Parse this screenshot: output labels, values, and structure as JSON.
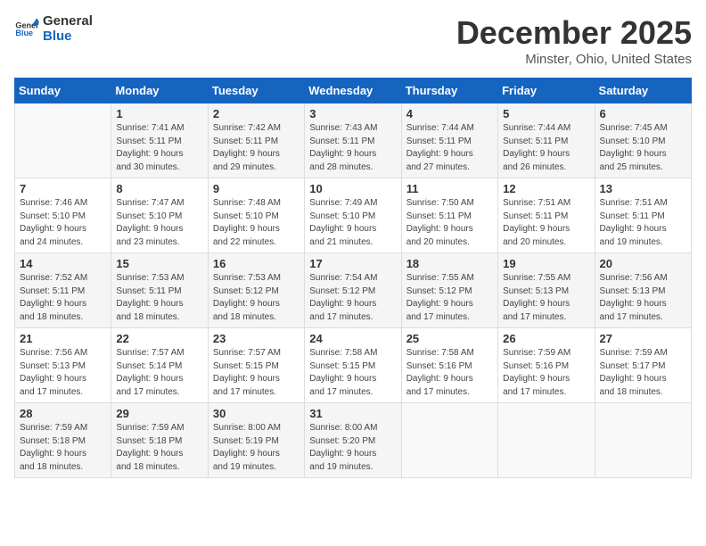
{
  "header": {
    "logo_general": "General",
    "logo_blue": "Blue",
    "month": "December 2025",
    "location": "Minster, Ohio, United States"
  },
  "weekdays": [
    "Sunday",
    "Monday",
    "Tuesday",
    "Wednesday",
    "Thursday",
    "Friday",
    "Saturday"
  ],
  "weeks": [
    [
      {
        "day": "",
        "info": ""
      },
      {
        "day": "1",
        "info": "Sunrise: 7:41 AM\nSunset: 5:11 PM\nDaylight: 9 hours\nand 30 minutes."
      },
      {
        "day": "2",
        "info": "Sunrise: 7:42 AM\nSunset: 5:11 PM\nDaylight: 9 hours\nand 29 minutes."
      },
      {
        "day": "3",
        "info": "Sunrise: 7:43 AM\nSunset: 5:11 PM\nDaylight: 9 hours\nand 28 minutes."
      },
      {
        "day": "4",
        "info": "Sunrise: 7:44 AM\nSunset: 5:11 PM\nDaylight: 9 hours\nand 27 minutes."
      },
      {
        "day": "5",
        "info": "Sunrise: 7:44 AM\nSunset: 5:11 PM\nDaylight: 9 hours\nand 26 minutes."
      },
      {
        "day": "6",
        "info": "Sunrise: 7:45 AM\nSunset: 5:10 PM\nDaylight: 9 hours\nand 25 minutes."
      }
    ],
    [
      {
        "day": "7",
        "info": "Sunrise: 7:46 AM\nSunset: 5:10 PM\nDaylight: 9 hours\nand 24 minutes."
      },
      {
        "day": "8",
        "info": "Sunrise: 7:47 AM\nSunset: 5:10 PM\nDaylight: 9 hours\nand 23 minutes."
      },
      {
        "day": "9",
        "info": "Sunrise: 7:48 AM\nSunset: 5:10 PM\nDaylight: 9 hours\nand 22 minutes."
      },
      {
        "day": "10",
        "info": "Sunrise: 7:49 AM\nSunset: 5:10 PM\nDaylight: 9 hours\nand 21 minutes."
      },
      {
        "day": "11",
        "info": "Sunrise: 7:50 AM\nSunset: 5:11 PM\nDaylight: 9 hours\nand 20 minutes."
      },
      {
        "day": "12",
        "info": "Sunrise: 7:51 AM\nSunset: 5:11 PM\nDaylight: 9 hours\nand 20 minutes."
      },
      {
        "day": "13",
        "info": "Sunrise: 7:51 AM\nSunset: 5:11 PM\nDaylight: 9 hours\nand 19 minutes."
      }
    ],
    [
      {
        "day": "14",
        "info": "Sunrise: 7:52 AM\nSunset: 5:11 PM\nDaylight: 9 hours\nand 18 minutes."
      },
      {
        "day": "15",
        "info": "Sunrise: 7:53 AM\nSunset: 5:11 PM\nDaylight: 9 hours\nand 18 minutes."
      },
      {
        "day": "16",
        "info": "Sunrise: 7:53 AM\nSunset: 5:12 PM\nDaylight: 9 hours\nand 18 minutes."
      },
      {
        "day": "17",
        "info": "Sunrise: 7:54 AM\nSunset: 5:12 PM\nDaylight: 9 hours\nand 17 minutes."
      },
      {
        "day": "18",
        "info": "Sunrise: 7:55 AM\nSunset: 5:12 PM\nDaylight: 9 hours\nand 17 minutes."
      },
      {
        "day": "19",
        "info": "Sunrise: 7:55 AM\nSunset: 5:13 PM\nDaylight: 9 hours\nand 17 minutes."
      },
      {
        "day": "20",
        "info": "Sunrise: 7:56 AM\nSunset: 5:13 PM\nDaylight: 9 hours\nand 17 minutes."
      }
    ],
    [
      {
        "day": "21",
        "info": "Sunrise: 7:56 AM\nSunset: 5:13 PM\nDaylight: 9 hours\nand 17 minutes."
      },
      {
        "day": "22",
        "info": "Sunrise: 7:57 AM\nSunset: 5:14 PM\nDaylight: 9 hours\nand 17 minutes."
      },
      {
        "day": "23",
        "info": "Sunrise: 7:57 AM\nSunset: 5:15 PM\nDaylight: 9 hours\nand 17 minutes."
      },
      {
        "day": "24",
        "info": "Sunrise: 7:58 AM\nSunset: 5:15 PM\nDaylight: 9 hours\nand 17 minutes."
      },
      {
        "day": "25",
        "info": "Sunrise: 7:58 AM\nSunset: 5:16 PM\nDaylight: 9 hours\nand 17 minutes."
      },
      {
        "day": "26",
        "info": "Sunrise: 7:59 AM\nSunset: 5:16 PM\nDaylight: 9 hours\nand 17 minutes."
      },
      {
        "day": "27",
        "info": "Sunrise: 7:59 AM\nSunset: 5:17 PM\nDaylight: 9 hours\nand 18 minutes."
      }
    ],
    [
      {
        "day": "28",
        "info": "Sunrise: 7:59 AM\nSunset: 5:18 PM\nDaylight: 9 hours\nand 18 minutes."
      },
      {
        "day": "29",
        "info": "Sunrise: 7:59 AM\nSunset: 5:18 PM\nDaylight: 9 hours\nand 18 minutes."
      },
      {
        "day": "30",
        "info": "Sunrise: 8:00 AM\nSunset: 5:19 PM\nDaylight: 9 hours\nand 19 minutes."
      },
      {
        "day": "31",
        "info": "Sunrise: 8:00 AM\nSunset: 5:20 PM\nDaylight: 9 hours\nand 19 minutes."
      },
      {
        "day": "",
        "info": ""
      },
      {
        "day": "",
        "info": ""
      },
      {
        "day": "",
        "info": ""
      }
    ]
  ]
}
